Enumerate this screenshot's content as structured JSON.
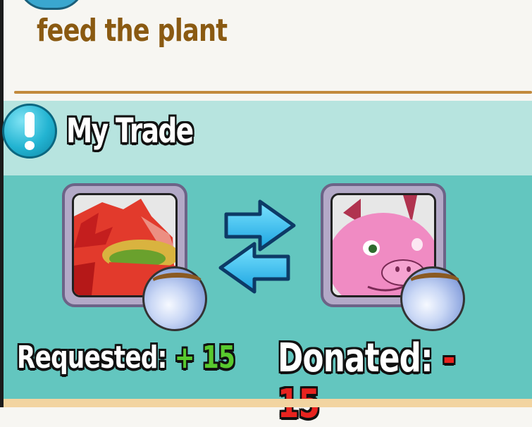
{
  "task": {
    "title": "feed the plant"
  },
  "trade": {
    "title": "My Trade",
    "requested": {
      "label": "Requested:",
      "value": "+ 15",
      "value_color": "#58c92e"
    },
    "donated": {
      "label": "Donated:",
      "value": "- 15",
      "value_color": "#e8231f"
    }
  },
  "icons": {
    "alert": "exclamation-icon",
    "swap": "swap-arrows-icon",
    "orb": "essence-orb-icon",
    "requested_monster": "red-dragon-portrait",
    "donated_monster": "pink-pig-portrait"
  },
  "colors": {
    "header_band": "#b7e4df",
    "body_band": "#63c6bf",
    "task_text": "#8a5a12",
    "divider": "#c28a3d"
  }
}
